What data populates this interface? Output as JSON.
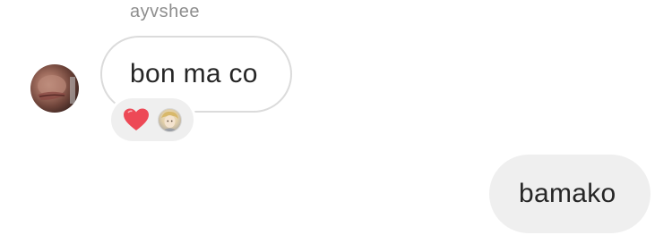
{
  "thread": {
    "incoming": {
      "sender": "ayvshee",
      "text": "bon ma co",
      "reactions": [
        {
          "type": "heart",
          "glyph": "❤️",
          "color": "#ed4956"
        },
        {
          "type": "reactor-avatar"
        }
      ]
    },
    "outgoing": {
      "text": "bamako"
    }
  },
  "colors": {
    "incoming_border": "#dbdbdb",
    "outgoing_fill": "#efefef",
    "text": "#262626",
    "sender_name": "#8e8e8e",
    "heart": "#ed4956"
  },
  "icons": {
    "heart_reaction": "heart-icon",
    "avatar": "avatar",
    "reactor_avatar": "reactor-avatar"
  }
}
